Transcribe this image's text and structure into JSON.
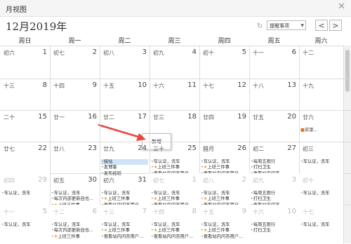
{
  "window": {
    "title": "月视图",
    "close": "✕"
  },
  "header": {
    "month": "12月2019年",
    "refresh_icon": "↻",
    "reminder_select": "提醒事项",
    "prev": "<",
    "next": ">"
  },
  "weekdays": [
    "周日",
    "周一",
    "周二",
    "周三",
    "周四",
    "周五",
    "周六"
  ],
  "weeks": [
    [
      {
        "lunar": "初六",
        "num": "1",
        "dim": false,
        "events": []
      },
      {
        "lunar": "初七",
        "num": "2",
        "dim": false,
        "events": []
      },
      {
        "lunar": "初八",
        "num": "3",
        "dim": false,
        "events": []
      },
      {
        "lunar": "初九",
        "num": "4",
        "dim": false,
        "events": []
      },
      {
        "lunar": "初十",
        "num": "5",
        "dim": false,
        "events": []
      },
      {
        "lunar": "十一",
        "num": "6",
        "dim": false,
        "events": []
      },
      {
        "lunar": "十二",
        "num": "",
        "dim": false,
        "events": []
      }
    ],
    [
      {
        "lunar": "十三",
        "num": "8",
        "dim": false,
        "events": []
      },
      {
        "lunar": "十四",
        "num": "9",
        "dim": false,
        "events": []
      },
      {
        "lunar": "十五",
        "num": "10",
        "dim": false,
        "events": []
      },
      {
        "lunar": "十六",
        "num": "11",
        "dim": false,
        "events": []
      },
      {
        "lunar": "十七",
        "num": "12",
        "dim": false,
        "events": []
      },
      {
        "lunar": "十八",
        "num": "13",
        "dim": false,
        "events": []
      },
      {
        "lunar": "十九",
        "num": "",
        "dim": false,
        "events": []
      }
    ],
    [
      {
        "lunar": "二十",
        "num": "15",
        "dim": false,
        "events": []
      },
      {
        "lunar": "廿一",
        "num": "16",
        "dim": false,
        "events": []
      },
      {
        "lunar": "廿二",
        "num": "17",
        "dim": false,
        "events": []
      },
      {
        "lunar": "廿三",
        "num": "18",
        "dim": false,
        "events": []
      },
      {
        "lunar": "廿四",
        "num": "19",
        "dim": false,
        "events": []
      },
      {
        "lunar": "廿五",
        "num": "20",
        "dim": false,
        "events": []
      },
      {
        "lunar": "廿六",
        "num": "",
        "dim": false,
        "events": [
          {
            "b": "",
            "s": "■",
            "t": "买菜..."
          }
        ]
      }
    ],
    [
      {
        "lunar": "廿七",
        "num": "22",
        "dim": false,
        "events": []
      },
      {
        "lunar": "廿八",
        "num": "23",
        "dim": false,
        "events": []
      },
      {
        "lunar": "廿九",
        "num": "24",
        "dim": false,
        "events": [
          {
            "b": "•",
            "s": "",
            "t": "接站",
            "hl": true
          },
          {
            "b": "•",
            "s": "",
            "t": "发博客"
          },
          {
            "b": "•",
            "s": "",
            "t": "发布经验"
          }
        ]
      },
      {
        "lunar": "三十",
        "num": "25",
        "dim": false,
        "events": [
          {
            "b": "•",
            "s": "",
            "t": "车认证，洗车"
          },
          {
            "b": "•",
            "s": "★",
            "t": "上班三件事"
          },
          {
            "b": "•",
            "s": "",
            "t": "查看站内问答用户..."
          }
        ]
      },
      {
        "lunar": "腊月",
        "num": "26",
        "dim": false,
        "events": [
          {
            "b": "•",
            "s": "",
            "t": "车认证，洗车"
          },
          {
            "b": "•",
            "s": "★",
            "t": "上班三件事"
          },
          {
            "b": "•",
            "s": "",
            "t": "查看站内问答用户..."
          }
        ]
      },
      {
        "lunar": "初二",
        "num": "27",
        "dim": false,
        "events": [
          {
            "b": "•",
            "s": "",
            "t": "每周五限行"
          },
          {
            "b": "•",
            "s": "",
            "t": "打扫卫生"
          },
          {
            "b": "•",
            "s": "",
            "t": "查看站内问答..."
          }
        ]
      },
      {
        "lunar": "初三",
        "num": "",
        "dim": false,
        "events": [
          {
            "b": "•",
            "s": "",
            "t": "车认证，洗车"
          }
        ]
      }
    ],
    [
      {
        "lunar": "初四",
        "num": "29",
        "dim": true,
        "events": [
          {
            "b": "•",
            "s": "",
            "t": "车认证，洗车"
          }
        ]
      },
      {
        "lunar": "初五",
        "num": "30",
        "dim": false,
        "events": [
          {
            "b": "•",
            "s": "",
            "t": "车认证，洗车"
          },
          {
            "b": "•",
            "s": "",
            "t": "每次内部更新自也..."
          },
          {
            "b": "•",
            "s": "★",
            "t": "上班三件事"
          }
        ]
      },
      {
        "lunar": "初六",
        "num": "31",
        "dim": false,
        "events": [
          {
            "b": "•",
            "s": "",
            "t": "车认证，洗车"
          },
          {
            "b": "•",
            "s": "★",
            "t": "上班三件事"
          },
          {
            "b": "•",
            "s": "",
            "t": "查看站内问答用户..."
          }
        ]
      },
      {
        "lunar": "初七",
        "num": "1",
        "dim": true,
        "events": [
          {
            "b": "•",
            "s": "",
            "t": "车认证，洗车"
          },
          {
            "b": "•",
            "s": "★",
            "t": "上班三件事"
          },
          {
            "b": "•",
            "s": "",
            "t": "查看站内问答用户..."
          }
        ]
      },
      {
        "lunar": "初八",
        "num": "2",
        "dim": true,
        "events": [
          {
            "b": "•",
            "s": "",
            "t": "车认证，洗车"
          },
          {
            "b": "•",
            "s": "★",
            "t": "上班三件事"
          },
          {
            "b": "•",
            "s": "",
            "t": "查看站内问答用户..."
          }
        ]
      },
      {
        "lunar": "初九",
        "num": "3",
        "dim": true,
        "events": [
          {
            "b": "•",
            "s": "",
            "t": "每周五限行"
          },
          {
            "b": "•",
            "s": "",
            "t": "打扫卫生"
          },
          {
            "b": "•",
            "s": "",
            "t": "查看站内问答..."
          }
        ]
      },
      {
        "lunar": "初十",
        "num": "",
        "dim": true,
        "events": [
          {
            "b": "•",
            "s": "",
            "t": "车认证，洗车"
          }
        ]
      }
    ],
    [
      {
        "lunar": "十一",
        "num": "5",
        "dim": true,
        "events": [
          {
            "b": "•",
            "s": "",
            "t": "车认证，洗车"
          }
        ]
      },
      {
        "lunar": "十二",
        "num": "6",
        "dim": true,
        "events": [
          {
            "b": "•",
            "s": "",
            "t": "车认证，洗车"
          },
          {
            "b": "•",
            "s": "",
            "t": "每次内部更新自也..."
          },
          {
            "b": "•",
            "s": "★",
            "t": "上班三件事"
          }
        ]
      },
      {
        "lunar": "十三",
        "num": "7",
        "dim": true,
        "events": [
          {
            "b": "•",
            "s": "",
            "t": "车认证，洗车"
          },
          {
            "b": "•",
            "s": "★",
            "t": "上班三件事"
          },
          {
            "b": "•",
            "s": "",
            "t": "查看站内问答用户..."
          }
        ]
      },
      {
        "lunar": "十四",
        "num": "8",
        "dim": true,
        "events": [
          {
            "b": "•",
            "s": "",
            "t": "车认证，洗车"
          },
          {
            "b": "•",
            "s": "★",
            "t": "上班三件事"
          },
          {
            "b": "•",
            "s": "",
            "t": "查看站内问答用户..."
          }
        ]
      },
      {
        "lunar": "十五",
        "num": "9",
        "dim": true,
        "events": [
          {
            "b": "•",
            "s": "",
            "t": "车认证，洗车"
          },
          {
            "b": "•",
            "s": "★",
            "t": "上班三件事"
          },
          {
            "b": "•",
            "s": "",
            "t": "查看站内问答用户..."
          }
        ]
      },
      {
        "lunar": "十六",
        "num": "10",
        "dim": true,
        "events": [
          {
            "b": "•",
            "s": "",
            "t": "每周五限行"
          },
          {
            "b": "•",
            "s": "",
            "t": "打扫卫生"
          }
        ]
      },
      {
        "lunar": "十七",
        "num": "",
        "dim": true,
        "events": [
          {
            "b": "•",
            "s": "",
            "t": "车认证，洗车"
          }
        ]
      }
    ]
  ],
  "popup": {
    "label": "新增"
  },
  "colors": {
    "arrow": "#e8453c",
    "highlight": "#cfe3f7",
    "star": "#f0a020"
  }
}
